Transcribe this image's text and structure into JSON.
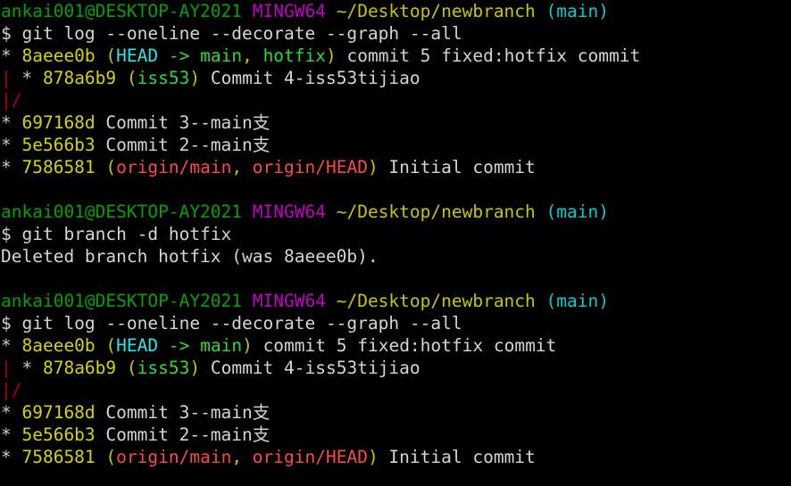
{
  "terminal": {
    "shell": "MINGW64",
    "colors": {
      "background": "#000000",
      "prompt_user": "#00a000",
      "prompt_shell": "#c000c0",
      "prompt_path": "#c5c500",
      "prompt_branch": "#00cdcd",
      "text": "#d3d7cf",
      "commit_hash": "#c5c500",
      "ref_head": "#24e7e7",
      "ref_local": "#29d93c",
      "ref_remote": "#f94a4a",
      "graph_line": "#b00000",
      "paren": "#c5c500"
    },
    "lines": [
      {
        "id": "prompt-1",
        "segments": [
          {
            "text": "ankai001@DESKTOP-AY2021",
            "color": "c-green",
            "name": "prompt-user-host"
          },
          {
            "text": " ",
            "color": "c-white",
            "name": "space"
          },
          {
            "text": "MINGW64",
            "color": "c-magenta",
            "name": "prompt-shell"
          },
          {
            "text": " ",
            "color": "c-white",
            "name": "space"
          },
          {
            "text": "~/Desktop/newbranch",
            "color": "c-olive",
            "name": "prompt-path"
          },
          {
            "text": " ",
            "color": "c-white",
            "name": "space"
          },
          {
            "text": "(main)",
            "color": "c-cyan",
            "name": "prompt-git-branch"
          }
        ]
      },
      {
        "id": "command-1",
        "segments": [
          {
            "text": "$ git log --oneline --decorate --graph --all",
            "color": "c-white",
            "name": "command-text"
          }
        ]
      },
      {
        "id": "log1-line-1",
        "segments": [
          {
            "text": "* ",
            "color": "c-gray",
            "name": "graph-node"
          },
          {
            "text": "8aeee0b",
            "color": "c-bryellow",
            "name": "commit-hash"
          },
          {
            "text": " ",
            "color": "c-white",
            "name": "space"
          },
          {
            "text": "(",
            "color": "c-yellow",
            "name": "paren-open"
          },
          {
            "text": "HEAD",
            "color": "c-brcyan",
            "name": "ref-head"
          },
          {
            "text": " -> ",
            "color": "c-brgreen",
            "name": "ref-arrow"
          },
          {
            "text": "main",
            "color": "c-brgreen",
            "name": "ref-main"
          },
          {
            "text": ", ",
            "color": "c-yellow",
            "name": "ref-separator"
          },
          {
            "text": "hotfix",
            "color": "c-brgreen",
            "name": "ref-hotfix"
          },
          {
            "text": ")",
            "color": "c-yellow",
            "name": "paren-close"
          },
          {
            "text": " commit 5 fixed:hotfix commit",
            "color": "c-white",
            "name": "commit-message"
          }
        ]
      },
      {
        "id": "log1-line-2",
        "segments": [
          {
            "text": "| ",
            "color": "c-darkred",
            "name": "graph-edge"
          },
          {
            "text": "* ",
            "color": "c-gray",
            "name": "graph-node"
          },
          {
            "text": "878a6b9",
            "color": "c-bryellow",
            "name": "commit-hash"
          },
          {
            "text": " ",
            "color": "c-white",
            "name": "space"
          },
          {
            "text": "(",
            "color": "c-yellow",
            "name": "paren-open"
          },
          {
            "text": "iss53",
            "color": "c-brgreen",
            "name": "ref-iss53"
          },
          {
            "text": ")",
            "color": "c-yellow",
            "name": "paren-close"
          },
          {
            "text": " Commit 4-iss53tijiao",
            "color": "c-white",
            "name": "commit-message"
          }
        ]
      },
      {
        "id": "log1-line-3",
        "segments": [
          {
            "text": "|/",
            "color": "c-darkred",
            "name": "graph-merge"
          }
        ]
      },
      {
        "id": "log1-line-4",
        "segments": [
          {
            "text": "* ",
            "color": "c-gray",
            "name": "graph-node"
          },
          {
            "text": "697168d",
            "color": "c-bryellow",
            "name": "commit-hash"
          },
          {
            "text": " Commit 3--main支",
            "color": "c-white",
            "name": "commit-message"
          }
        ]
      },
      {
        "id": "log1-line-5",
        "segments": [
          {
            "text": "* ",
            "color": "c-gray",
            "name": "graph-node"
          },
          {
            "text": "5e566b3",
            "color": "c-bryellow",
            "name": "commit-hash"
          },
          {
            "text": " Commit 2--main支",
            "color": "c-white",
            "name": "commit-message"
          }
        ]
      },
      {
        "id": "log1-line-6",
        "segments": [
          {
            "text": "* ",
            "color": "c-gray",
            "name": "graph-node"
          },
          {
            "text": "7586581",
            "color": "c-bryellow",
            "name": "commit-hash"
          },
          {
            "text": " ",
            "color": "c-white",
            "name": "space"
          },
          {
            "text": "(",
            "color": "c-yellow",
            "name": "paren-open"
          },
          {
            "text": "origin/main",
            "color": "c-brred",
            "name": "ref-origin-main"
          },
          {
            "text": ", ",
            "color": "c-yellow",
            "name": "ref-separator"
          },
          {
            "text": "origin/HEAD",
            "color": "c-brred",
            "name": "ref-origin-head"
          },
          {
            "text": ")",
            "color": "c-yellow",
            "name": "paren-close"
          },
          {
            "text": " Initial commit",
            "color": "c-white",
            "name": "commit-message"
          }
        ]
      },
      {
        "id": "blank-1",
        "segments": []
      },
      {
        "id": "prompt-2",
        "segments": [
          {
            "text": "ankai001@DESKTOP-AY2021",
            "color": "c-green",
            "name": "prompt-user-host"
          },
          {
            "text": " ",
            "color": "c-white",
            "name": "space"
          },
          {
            "text": "MINGW64",
            "color": "c-magenta",
            "name": "prompt-shell"
          },
          {
            "text": " ",
            "color": "c-white",
            "name": "space"
          },
          {
            "text": "~/Desktop/newbranch",
            "color": "c-olive",
            "name": "prompt-path"
          },
          {
            "text": " ",
            "color": "c-white",
            "name": "space"
          },
          {
            "text": "(main)",
            "color": "c-cyan",
            "name": "prompt-git-branch"
          }
        ]
      },
      {
        "id": "command-2",
        "segments": [
          {
            "text": "$ git branch -d hotfix",
            "color": "c-white",
            "name": "command-text"
          }
        ]
      },
      {
        "id": "output-2",
        "segments": [
          {
            "text": "Deleted branch hotfix (was 8aeee0b).",
            "color": "c-white",
            "name": "command-output"
          }
        ]
      },
      {
        "id": "blank-2",
        "segments": []
      },
      {
        "id": "prompt-3",
        "segments": [
          {
            "text": "ankai001@DESKTOP-AY2021",
            "color": "c-green",
            "name": "prompt-user-host"
          },
          {
            "text": " ",
            "color": "c-white",
            "name": "space"
          },
          {
            "text": "MINGW64",
            "color": "c-magenta",
            "name": "prompt-shell"
          },
          {
            "text": " ",
            "color": "c-white",
            "name": "space"
          },
          {
            "text": "~/Desktop/newbranch",
            "color": "c-olive",
            "name": "prompt-path"
          },
          {
            "text": " ",
            "color": "c-white",
            "name": "space"
          },
          {
            "text": "(main)",
            "color": "c-cyan",
            "name": "prompt-git-branch"
          }
        ]
      },
      {
        "id": "command-3",
        "segments": [
          {
            "text": "$ git log --oneline --decorate --graph --all",
            "color": "c-white",
            "name": "command-text"
          }
        ]
      },
      {
        "id": "log2-line-1",
        "segments": [
          {
            "text": "* ",
            "color": "c-gray",
            "name": "graph-node"
          },
          {
            "text": "8aeee0b",
            "color": "c-bryellow",
            "name": "commit-hash"
          },
          {
            "text": " ",
            "color": "c-white",
            "name": "space"
          },
          {
            "text": "(",
            "color": "c-yellow",
            "name": "paren-open"
          },
          {
            "text": "HEAD",
            "color": "c-brcyan",
            "name": "ref-head"
          },
          {
            "text": " -> ",
            "color": "c-brgreen",
            "name": "ref-arrow"
          },
          {
            "text": "main",
            "color": "c-brgreen",
            "name": "ref-main"
          },
          {
            "text": ")",
            "color": "c-yellow",
            "name": "paren-close"
          },
          {
            "text": " commit 5 fixed:hotfix commit",
            "color": "c-white",
            "name": "commit-message"
          }
        ]
      },
      {
        "id": "log2-line-2",
        "segments": [
          {
            "text": "| ",
            "color": "c-darkred",
            "name": "graph-edge"
          },
          {
            "text": "* ",
            "color": "c-gray",
            "name": "graph-node"
          },
          {
            "text": "878a6b9",
            "color": "c-bryellow",
            "name": "commit-hash"
          },
          {
            "text": " ",
            "color": "c-white",
            "name": "space"
          },
          {
            "text": "(",
            "color": "c-yellow",
            "name": "paren-open"
          },
          {
            "text": "iss53",
            "color": "c-brgreen",
            "name": "ref-iss53"
          },
          {
            "text": ")",
            "color": "c-yellow",
            "name": "paren-close"
          },
          {
            "text": " Commit 4-iss53tijiao",
            "color": "c-white",
            "name": "commit-message"
          }
        ]
      },
      {
        "id": "log2-line-3",
        "segments": [
          {
            "text": "|/",
            "color": "c-darkred",
            "name": "graph-merge"
          }
        ]
      },
      {
        "id": "log2-line-4",
        "segments": [
          {
            "text": "* ",
            "color": "c-gray",
            "name": "graph-node"
          },
          {
            "text": "697168d",
            "color": "c-bryellow",
            "name": "commit-hash"
          },
          {
            "text": " Commit 3--main支",
            "color": "c-white",
            "name": "commit-message"
          }
        ]
      },
      {
        "id": "log2-line-5",
        "segments": [
          {
            "text": "* ",
            "color": "c-gray",
            "name": "graph-node"
          },
          {
            "text": "5e566b3",
            "color": "c-bryellow",
            "name": "commit-hash"
          },
          {
            "text": " Commit 2--main支",
            "color": "c-white",
            "name": "commit-message"
          }
        ]
      },
      {
        "id": "log2-line-6",
        "segments": [
          {
            "text": "* ",
            "color": "c-gray",
            "name": "graph-node"
          },
          {
            "text": "7586581",
            "color": "c-bryellow",
            "name": "commit-hash"
          },
          {
            "text": " ",
            "color": "c-white",
            "name": "space"
          },
          {
            "text": "(",
            "color": "c-yellow",
            "name": "paren-open"
          },
          {
            "text": "origin/main",
            "color": "c-brred",
            "name": "ref-origin-main"
          },
          {
            "text": ", ",
            "color": "c-yellow",
            "name": "ref-separator"
          },
          {
            "text": "origin/HEAD",
            "color": "c-brred",
            "name": "ref-origin-head"
          },
          {
            "text": ")",
            "color": "c-yellow",
            "name": "paren-close"
          },
          {
            "text": " Initial commit",
            "color": "c-white",
            "name": "commit-message"
          }
        ]
      }
    ]
  }
}
